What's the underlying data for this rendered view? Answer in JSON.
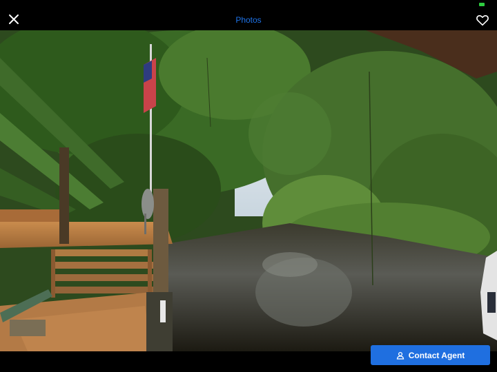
{
  "header": {
    "title": "Photos",
    "close_icon": "close-icon",
    "favorite_icon": "heart-icon"
  },
  "photo": {
    "alt": "Canal with wooden dock and flag"
  },
  "footer": {
    "contact_label": "Contact Agent",
    "contact_icon": "person-icon"
  },
  "colors": {
    "accent": "#1f6fe0",
    "title": "#1e73e8",
    "status_green": "#2ecc40"
  }
}
